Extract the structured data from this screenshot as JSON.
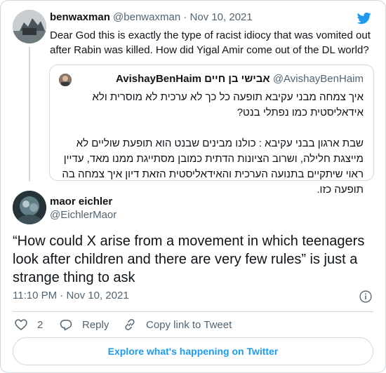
{
  "brand": {
    "icon": "twitter-bird-icon",
    "color": "#1d9bf0"
  },
  "parent_tweet": {
    "display_name": "benwaxman",
    "handle": "@benwaxman",
    "separator": "·",
    "date": "Nov 10, 2021",
    "text": "Dear God this is exactly the type of racist idiocy that was vomited out after Rabin was killed. How did Yigal Amir come out of the DL world?",
    "quoted_tweet": {
      "display_name": "AvishayBenHaim אבישי בן חיים",
      "handle": "@AvishayBenHaim",
      "paragraphs": [
        "איך צמחה מבני עקיבא תופעה כל כך לא ערכית לא מוסרית ולא אידאליסטית כמו נפתלי בנט?",
        "שבת ארגון בבני עקיבא : כולנו מבינים שבנט הוא תופעת שוליים לא מייצגת חלילה, ושרוב הציונות הדתית כמובן מסתייגת ממנו מאד, עדיין ראוי שיתקיים בתנועה הערכית והאידאליסטית הזאת דיון איך צמחה בה תופעה כזו."
      ]
    }
  },
  "main_tweet": {
    "display_name": "maor eichler",
    "handle": "@EichlerMaor",
    "text": "“How could X arise from a movement in which teenagers look after children and there are very few rules” is just a strange thing to ask",
    "time": "11:10 PM",
    "separator": "·",
    "date": "Nov 10, 2021",
    "like_count": "2",
    "reply_label": "Reply",
    "copy_link_label": "Copy link to Tweet",
    "explore_label": "Explore what's happening on Twitter"
  }
}
